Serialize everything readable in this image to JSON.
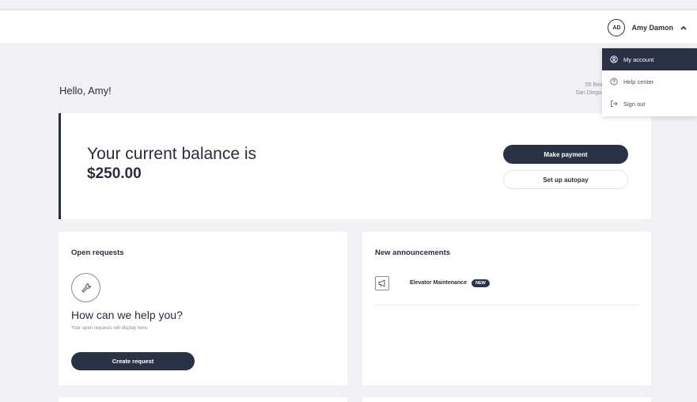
{
  "header": {
    "avatar_initials": "AD",
    "user_name": "Amy Damon"
  },
  "dropdown": {
    "items": [
      {
        "label": "My account",
        "icon": "user-circle-icon",
        "active": true
      },
      {
        "label": "Help center",
        "icon": "question-circle-icon",
        "active": false
      },
      {
        "label": "Sign out",
        "icon": "sign-out-icon",
        "active": false
      }
    ]
  },
  "greeting": "Hello, Amy!",
  "address": {
    "line1": "55 Bea",
    "line2": "San Diego,"
  },
  "balance": {
    "label": "Your current balance is",
    "amount": "$250.00",
    "pay_button": "Make payment",
    "autopay_button": "Set up autopay"
  },
  "requests": {
    "title": "Open requests",
    "heading": "How can we help you?",
    "subtext": "Your open requests will display here.",
    "button": "Create request"
  },
  "announcements": {
    "title": "New announcements",
    "items": [
      {
        "text": "Elevator Maintenance",
        "badge": "NEW"
      }
    ]
  },
  "colors": {
    "primary": "#2c3245",
    "background": "#f1f1f3",
    "text": "#2a2d3a"
  }
}
